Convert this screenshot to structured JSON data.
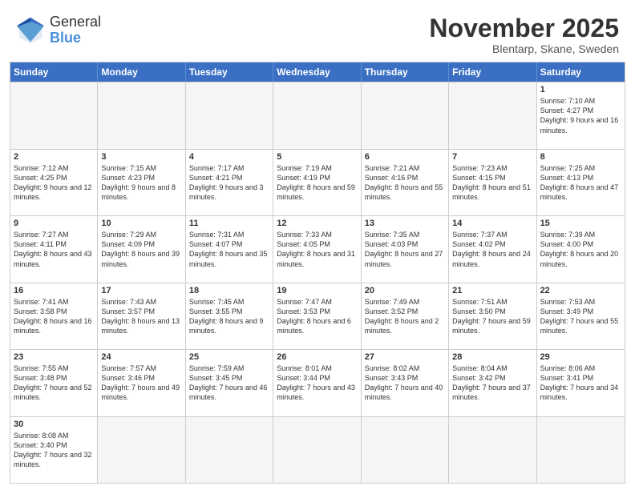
{
  "header": {
    "logo_general": "General",
    "logo_blue": "Blue",
    "month_title": "November 2025",
    "location": "Blentarp, Skane, Sweden"
  },
  "days_of_week": [
    "Sunday",
    "Monday",
    "Tuesday",
    "Wednesday",
    "Thursday",
    "Friday",
    "Saturday"
  ],
  "rows": [
    [
      {
        "day": "",
        "empty": true
      },
      {
        "day": "",
        "empty": true
      },
      {
        "day": "",
        "empty": true
      },
      {
        "day": "",
        "empty": true
      },
      {
        "day": "",
        "empty": true
      },
      {
        "day": "",
        "empty": true
      },
      {
        "day": "1",
        "sunrise": "7:10 AM",
        "sunset": "4:27 PM",
        "daylight": "9 hours and 16 minutes."
      }
    ],
    [
      {
        "day": "2",
        "sunrise": "7:12 AM",
        "sunset": "4:25 PM",
        "daylight": "9 hours and 12 minutes."
      },
      {
        "day": "3",
        "sunrise": "7:15 AM",
        "sunset": "4:23 PM",
        "daylight": "9 hours and 8 minutes."
      },
      {
        "day": "4",
        "sunrise": "7:17 AM",
        "sunset": "4:21 PM",
        "daylight": "9 hours and 3 minutes."
      },
      {
        "day": "5",
        "sunrise": "7:19 AM",
        "sunset": "4:19 PM",
        "daylight": "8 hours and 59 minutes."
      },
      {
        "day": "6",
        "sunrise": "7:21 AM",
        "sunset": "4:16 PM",
        "daylight": "8 hours and 55 minutes."
      },
      {
        "day": "7",
        "sunrise": "7:23 AM",
        "sunset": "4:15 PM",
        "daylight": "8 hours and 51 minutes."
      },
      {
        "day": "8",
        "sunrise": "7:25 AM",
        "sunset": "4:13 PM",
        "daylight": "8 hours and 47 minutes."
      }
    ],
    [
      {
        "day": "9",
        "sunrise": "7:27 AM",
        "sunset": "4:11 PM",
        "daylight": "8 hours and 43 minutes."
      },
      {
        "day": "10",
        "sunrise": "7:29 AM",
        "sunset": "4:09 PM",
        "daylight": "8 hours and 39 minutes."
      },
      {
        "day": "11",
        "sunrise": "7:31 AM",
        "sunset": "4:07 PM",
        "daylight": "8 hours and 35 minutes."
      },
      {
        "day": "12",
        "sunrise": "7:33 AM",
        "sunset": "4:05 PM",
        "daylight": "8 hours and 31 minutes."
      },
      {
        "day": "13",
        "sunrise": "7:35 AM",
        "sunset": "4:03 PM",
        "daylight": "8 hours and 27 minutes."
      },
      {
        "day": "14",
        "sunrise": "7:37 AM",
        "sunset": "4:02 PM",
        "daylight": "8 hours and 24 minutes."
      },
      {
        "day": "15",
        "sunrise": "7:39 AM",
        "sunset": "4:00 PM",
        "daylight": "8 hours and 20 minutes."
      }
    ],
    [
      {
        "day": "16",
        "sunrise": "7:41 AM",
        "sunset": "3:58 PM",
        "daylight": "8 hours and 16 minutes."
      },
      {
        "day": "17",
        "sunrise": "7:43 AM",
        "sunset": "3:57 PM",
        "daylight": "8 hours and 13 minutes."
      },
      {
        "day": "18",
        "sunrise": "7:45 AM",
        "sunset": "3:55 PM",
        "daylight": "8 hours and 9 minutes."
      },
      {
        "day": "19",
        "sunrise": "7:47 AM",
        "sunset": "3:53 PM",
        "daylight": "8 hours and 6 minutes."
      },
      {
        "day": "20",
        "sunrise": "7:49 AM",
        "sunset": "3:52 PM",
        "daylight": "8 hours and 2 minutes."
      },
      {
        "day": "21",
        "sunrise": "7:51 AM",
        "sunset": "3:50 PM",
        "daylight": "7 hours and 59 minutes."
      },
      {
        "day": "22",
        "sunrise": "7:53 AM",
        "sunset": "3:49 PM",
        "daylight": "7 hours and 55 minutes."
      }
    ],
    [
      {
        "day": "23",
        "sunrise": "7:55 AM",
        "sunset": "3:48 PM",
        "daylight": "7 hours and 52 minutes."
      },
      {
        "day": "24",
        "sunrise": "7:57 AM",
        "sunset": "3:46 PM",
        "daylight": "7 hours and 49 minutes."
      },
      {
        "day": "25",
        "sunrise": "7:59 AM",
        "sunset": "3:45 PM",
        "daylight": "7 hours and 46 minutes."
      },
      {
        "day": "26",
        "sunrise": "8:01 AM",
        "sunset": "3:44 PM",
        "daylight": "7 hours and 43 minutes."
      },
      {
        "day": "27",
        "sunrise": "8:02 AM",
        "sunset": "3:43 PM",
        "daylight": "7 hours and 40 minutes."
      },
      {
        "day": "28",
        "sunrise": "8:04 AM",
        "sunset": "3:42 PM",
        "daylight": "7 hours and 37 minutes."
      },
      {
        "day": "29",
        "sunrise": "8:06 AM",
        "sunset": "3:41 PM",
        "daylight": "7 hours and 34 minutes."
      }
    ],
    [
      {
        "day": "30",
        "sunrise": "8:08 AM",
        "sunset": "3:40 PM",
        "daylight": "7 hours and 32 minutes."
      },
      {
        "day": "",
        "empty": true
      },
      {
        "day": "",
        "empty": true
      },
      {
        "day": "",
        "empty": true
      },
      {
        "day": "",
        "empty": true
      },
      {
        "day": "",
        "empty": true
      },
      {
        "day": "",
        "empty": true
      }
    ]
  ]
}
